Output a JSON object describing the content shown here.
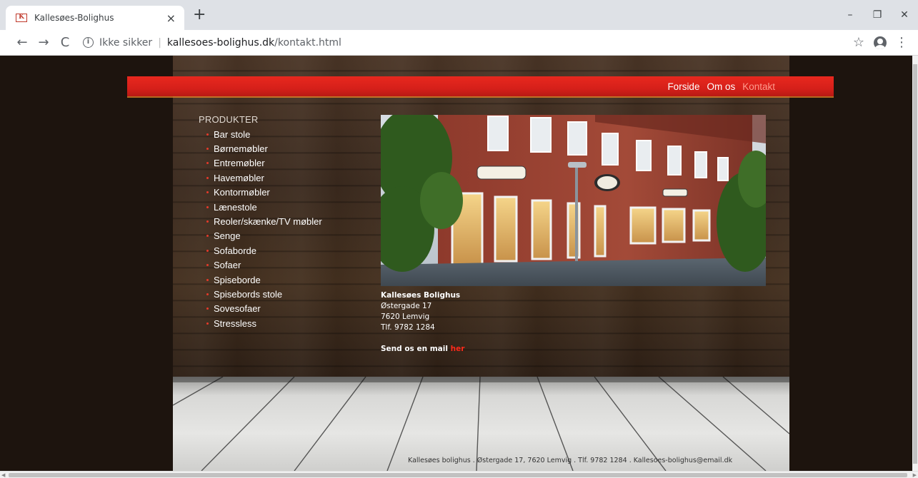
{
  "browser": {
    "tab_title": "Kallesøes-Bolighus",
    "tab_close": "×",
    "new_tab": "+",
    "favicon_text": "K",
    "insecure_label": "Ikke sikker",
    "url_separator": "|",
    "url_host": "kallesoes-bolighus.dk",
    "url_path": "/kontakt.html",
    "icons": {
      "back": "←",
      "forward": "→",
      "reload": "C",
      "info": "i",
      "bookmark": "☆",
      "menu": "⋮",
      "minimize": "–",
      "restore": "❐",
      "close": "✕"
    }
  },
  "nav": {
    "items": [
      {
        "label": "Forside"
      },
      {
        "label": "Om os"
      },
      {
        "label": "Kontakt"
      }
    ],
    "active_color": "#ff9a8c",
    "bar_color": "#d6201a"
  },
  "sidebar": {
    "heading": "PRODUKTER",
    "items": [
      {
        "label": "Bar stole"
      },
      {
        "label": "Børnemøbler"
      },
      {
        "label": "Entremøbler"
      },
      {
        "label": "Havemøbler"
      },
      {
        "label": "Kontormøbler"
      },
      {
        "label": "Lænestole"
      },
      {
        "label": "Reoler/skænke/TV møbler"
      },
      {
        "label": "Senge"
      },
      {
        "label": "Sofaborde"
      },
      {
        "label": "Sofaer"
      },
      {
        "label": "Spiseborde"
      },
      {
        "label": "Spisebords stole"
      },
      {
        "label": "Sovesofaer"
      },
      {
        "label": "Stressless"
      }
    ]
  },
  "contact": {
    "name": "Kallesøes Bolighus",
    "street": "Østergade 17",
    "city": "7620 Lemvig",
    "phone": "Tlf. 9782 1284",
    "mail_text": "Send os en mail",
    "mail_link": "her"
  },
  "footer": {
    "text": "Kallesøes bolighus . Østergade 17, 7620 Lemvig . Tlf. 9782 1284 . Kallesoes-bolighus@email.dk"
  }
}
